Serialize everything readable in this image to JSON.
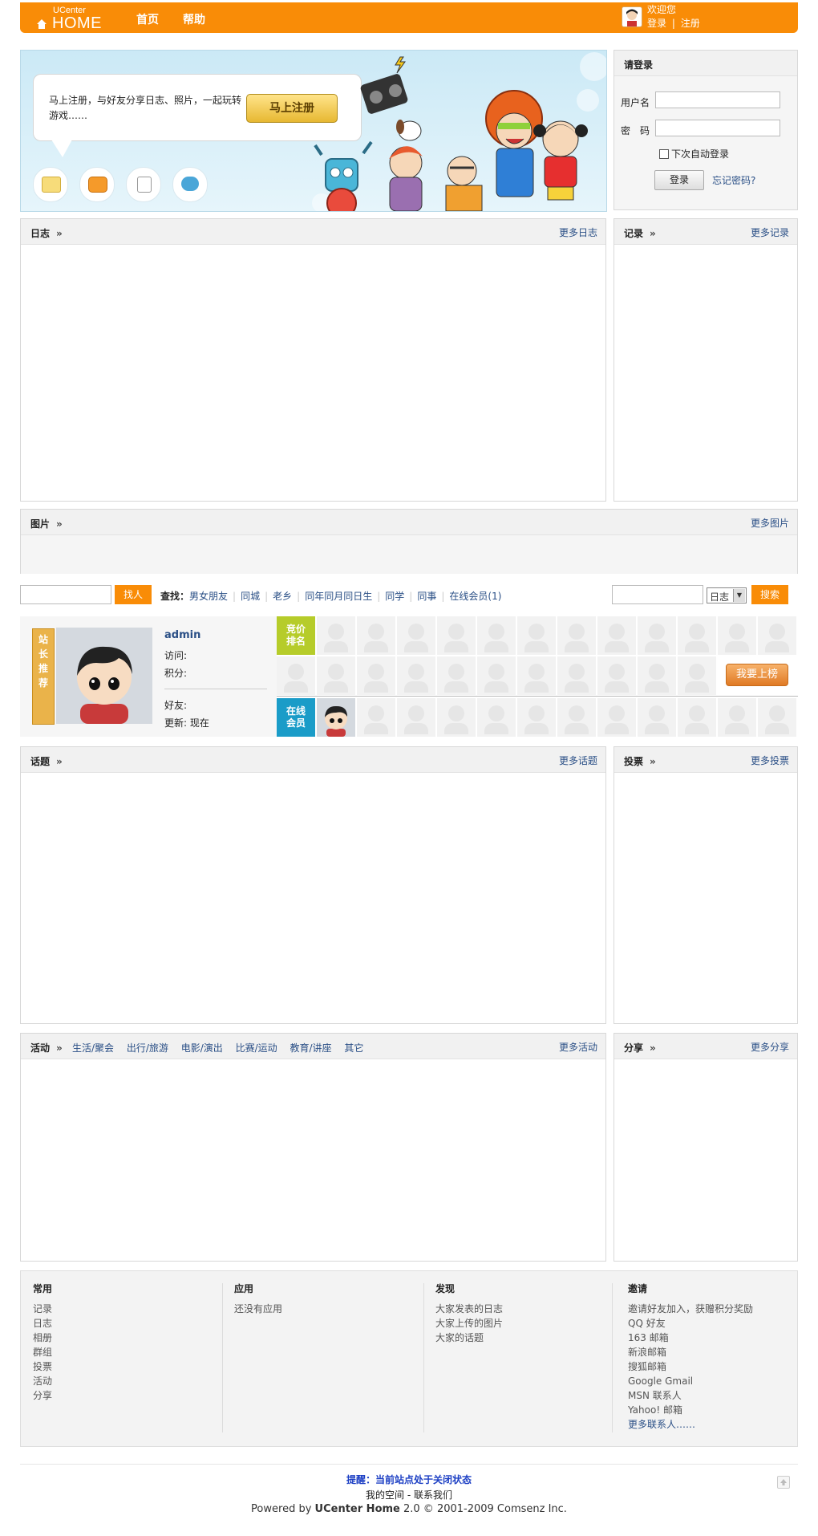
{
  "topbar": {
    "logo_small": "UCenter",
    "logo_big": "HOME",
    "nav": [
      "首页",
      "帮助"
    ],
    "welcome": "欢迎您",
    "login": "登录",
    "divider": "|",
    "register": "注册"
  },
  "banner": {
    "text": "马上注册，与好友分享日志、照片，一起玩转游戏……",
    "button": "马上注册"
  },
  "login_box": {
    "title": "请登录",
    "username_label": "用户名",
    "password_label": "密　码",
    "remember": "下次自动登录",
    "button": "登录",
    "forgot": "忘记密码?"
  },
  "blog_box": {
    "title": "日志",
    "more": "更多日志"
  },
  "record_box": {
    "title": "记录",
    "more": "更多记录"
  },
  "photo_box": {
    "title": "图片",
    "more": "更多图片"
  },
  "search": {
    "find_button": "找人",
    "find_label": "查找：",
    "links": [
      "男女朋友",
      "同城",
      "老乡",
      "同年同月同日生",
      "同学",
      "同事",
      "在线会员(1)"
    ],
    "select_value": "日志",
    "search_button": "搜索"
  },
  "members": {
    "star_tag": [
      "站",
      "长",
      "推",
      "荐"
    ],
    "name": "admin",
    "visits_label": "访问:",
    "points_label": "积分:",
    "friends_label": "好友:",
    "update_label": "更新:",
    "update_value": "现在",
    "rank_tag": [
      "竞价",
      "排名"
    ],
    "online_tag": [
      "在线",
      "会员"
    ],
    "rank_button": "我要上榜"
  },
  "topic_box": {
    "title": "话题",
    "more": "更多话题"
  },
  "poll_box": {
    "title": "投票",
    "more": "更多投票"
  },
  "event_box": {
    "title": "活动",
    "categories": [
      "生活/聚会",
      "出行/旅游",
      "电影/演出",
      "比赛/运动",
      "教育/讲座",
      "其它"
    ],
    "more": "更多活动"
  },
  "share_box": {
    "title": "分享",
    "more": "更多分享"
  },
  "footer_nav": {
    "common": {
      "title": "常用",
      "items": [
        "记录",
        "日志",
        "相册",
        "群组",
        "投票",
        "活动",
        "分享"
      ]
    },
    "apps": {
      "title": "应用",
      "items": [
        "还没有应用"
      ]
    },
    "discover": {
      "title": "发现",
      "items": [
        "大家发表的日志",
        "大家上传的图片",
        "大家的话题"
      ]
    },
    "invite": {
      "title": "邀请",
      "items": [
        "邀请好友加入，获赠积分奖励",
        "QQ 好友",
        "163 邮箱",
        "新浪邮箱",
        "搜狐邮箱",
        "Google Gmail",
        "MSN 联系人",
        "Yahoo! 邮箱",
        "更多联系人……"
      ]
    }
  },
  "footer": {
    "notice": "提醒：当前站点处于关闭状态",
    "links": "我的空间 - 联系我们",
    "powered_prefix": "Powered by",
    "powered_brand": "UCenter Home",
    "powered_suffix": "2.0 © 2001-2009 Comsenz Inc."
  },
  "colors": {
    "accent": "#f98c07",
    "link": "#2a4f86",
    "online_tag": "#1a9cc8",
    "rank_tag": "#b6cc2a"
  }
}
